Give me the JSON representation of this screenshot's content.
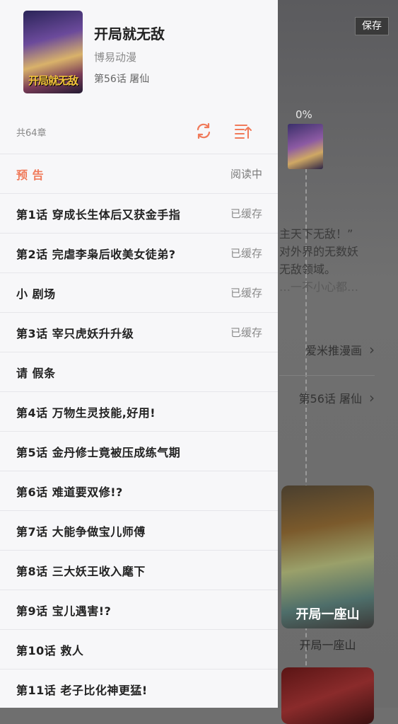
{
  "background": {
    "save_label": "保存",
    "progress_pct": "0%",
    "intro_lines": [
      "主天下无敌！”",
      "对外界的无数妖",
      "无敌领域。",
      "…一不小心都…"
    ],
    "rows": [
      {
        "label": "爱米推漫画"
      },
      {
        "label": "第56话 屠仙"
      }
    ],
    "card_title": "开局一座山",
    "card_cover_text": "开局一座山"
  },
  "drawer": {
    "comic": {
      "title": "开局就无敌",
      "author": "博易动漫",
      "progress": "第56话 屠仙",
      "cover_text": "开局就无敌"
    },
    "chapter_count": "共64章",
    "icons": {
      "refresh": "refresh-icon",
      "sort": "sort-icon"
    },
    "accent_color": "#f07a5a",
    "chapters": [
      {
        "name": "预 告",
        "status": "阅读中"
      },
      {
        "name": "第1话  穿成长生体后又获金手指",
        "status": "已缓存"
      },
      {
        "name": "第2话  完虐李枭后收美女徒弟?",
        "status": "已缓存"
      },
      {
        "name": "小 剧场",
        "status": "已缓存"
      },
      {
        "name": "第3话  宰只虎妖升升级",
        "status": "已缓存"
      },
      {
        "name": "请 假条",
        "status": ""
      },
      {
        "name": "第4话  万物生灵技能,好用!",
        "status": ""
      },
      {
        "name": "第5话  金丹修士竟被压成练气期",
        "status": ""
      },
      {
        "name": "第6话  难道要双修!?",
        "status": ""
      },
      {
        "name": "第7话  大能争做宝儿师傅",
        "status": ""
      },
      {
        "name": "第8话  三大妖王收入麾下",
        "status": ""
      },
      {
        "name": "第9话  宝儿遇害!?",
        "status": ""
      },
      {
        "name": "第10话  救人",
        "status": ""
      },
      {
        "name": "第11话  老子比化神更猛!",
        "status": ""
      }
    ]
  }
}
